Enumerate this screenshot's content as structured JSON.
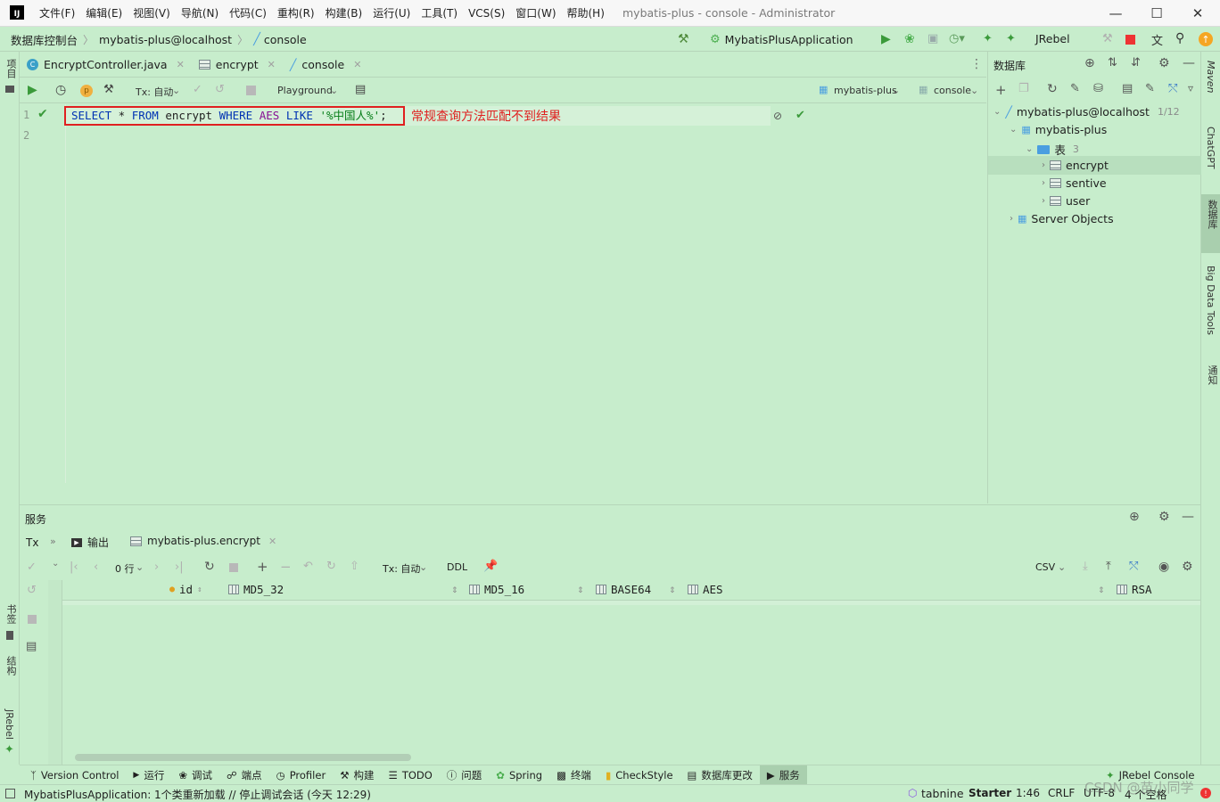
{
  "title_bar": {
    "logo": "IJ",
    "menus": [
      "文件(F)",
      "编辑(E)",
      "视图(V)",
      "导航(N)",
      "代码(C)",
      "重构(R)",
      "构建(B)",
      "运行(U)",
      "工具(T)",
      "VCS(S)",
      "窗口(W)",
      "帮助(H)"
    ],
    "window_title": "mybatis-plus - console - Administrator"
  },
  "nav_bar": {
    "breadcrumbs": [
      "数据库控制台",
      "mybatis-plus@localhost",
      "console"
    ],
    "run_config": "MybatisPlusApplication",
    "jrebel": "JRebel"
  },
  "left_strip": {
    "project": "项目",
    "bookmarks": "书签",
    "structure": "结构",
    "jrebel": "JRebel"
  },
  "right_strip": {
    "maven": "Maven",
    "chatgpt": "ChatGPT",
    "database": "数据库",
    "bigdata": "Big Data Tools",
    "notifications": "通知"
  },
  "editor_tabs": [
    {
      "label": "EncryptController.java",
      "icon": "class-icon"
    },
    {
      "label": "encrypt",
      "icon": "table-icon"
    },
    {
      "label": "console",
      "icon": "console-icon"
    }
  ],
  "editor_toolbar": {
    "tx": "Tx: 自动",
    "playground": "Playground",
    "schema": "mybatis-plus",
    "session": "console"
  },
  "editor": {
    "line_numbers": [
      "1",
      "2"
    ],
    "sql": {
      "select": "SELECT",
      "star": " * ",
      "from": "FROM",
      "table": " encrypt ",
      "where": "WHERE",
      "col": " AES ",
      "like": "LIKE",
      "space": " ",
      "pattern": "'%中国人%'",
      "semicolon": ";"
    },
    "annotation": "常规查询方法匹配不到结果"
  },
  "db_panel": {
    "title": "数据库",
    "datasource": "mybatis-plus@localhost",
    "datasource_count": "1/12",
    "schema": "mybatis-plus",
    "tables_folder": "表",
    "tables_count": "3",
    "tables": [
      "encrypt",
      "sentive",
      "user"
    ],
    "server_objects": "Server Objects"
  },
  "services": {
    "title": "服务",
    "tx": "Tx",
    "tabs": [
      "输出",
      "mybatis-plus.encrypt"
    ],
    "rows": "0 行",
    "tx_auto": "Tx: 自动",
    "ddl": "DDL",
    "export": "CSV",
    "columns": [
      "id",
      "MD5_32",
      "MD5_16",
      "BASE64",
      "AES",
      "RSA"
    ]
  },
  "bottom_tabs": [
    "Version Control",
    "运行",
    "调试",
    "端点",
    "Profiler",
    "构建",
    "TODO",
    "问题",
    "Spring",
    "终端",
    "CheckStyle",
    "数据库更改",
    "服务"
  ],
  "bottom_right_tab": "JRebel Console",
  "status_bar": {
    "message": "MybatisPlusApplication: 1个类重新加载 // 停止调试会话 (今天 12:29)",
    "tabnine": "tabnine",
    "tabnine_plan": "Starter",
    "position": "1:46",
    "line_sep": "CRLF",
    "encoding": "UTF-8",
    "indent": "4 个空格",
    "watermark": "CSDN @苗小同学"
  }
}
